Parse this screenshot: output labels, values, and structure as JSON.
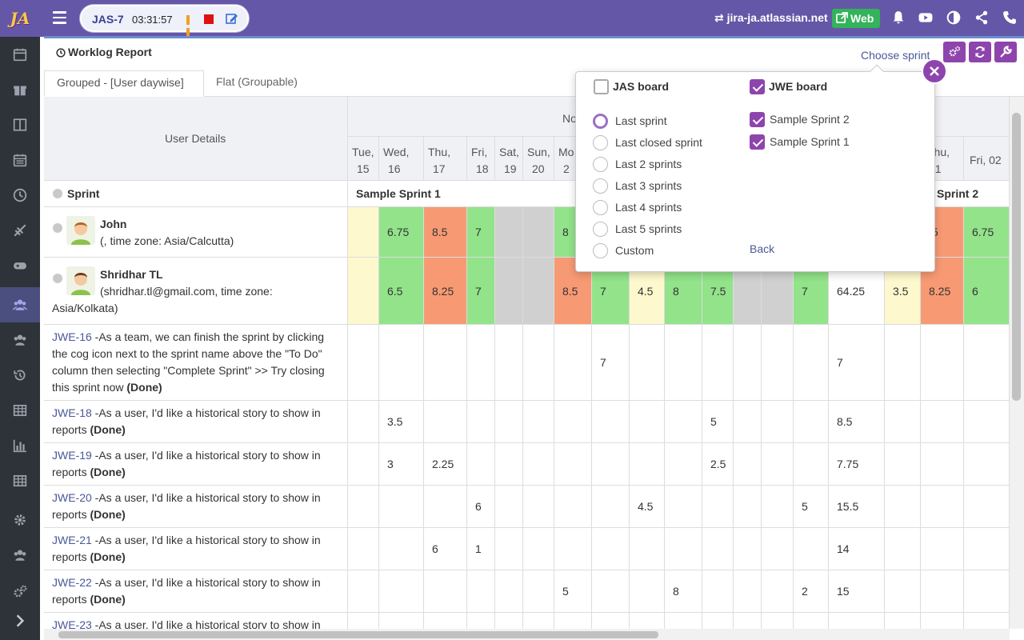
{
  "app": {
    "logo": "JA"
  },
  "timer": {
    "issue_key": "JAS-7",
    "time": "03:31:57"
  },
  "topbar": {
    "instance": "jira-ja.atlassian.net",
    "web_label": "Web"
  },
  "sidebar": {
    "items": [
      "calendar-icon",
      "gift-icon",
      "columns-icon",
      "calendar-icon",
      "clock-icon",
      "plane-icon",
      "gamepad-icon",
      "users-icon",
      "users-icon",
      "history-icon",
      "table-icon",
      "bar-chart-icon",
      "table-icon",
      "gear-icon",
      "users-icon",
      "gears-icon",
      "chevron-right-icon"
    ],
    "active_index": 7
  },
  "report": {
    "title": "Worklog Report",
    "choose_sprint": "Choose sprint"
  },
  "tabs": [
    {
      "label": "Grouped - [User daywise]"
    },
    {
      "label": "Flat (Groupable)"
    }
  ],
  "grid": {
    "user_details_header": "User Details",
    "month_header": "No",
    "days": [
      {
        "day": "Tue,",
        "date": "15"
      },
      {
        "day": "Wed,",
        "date": "16"
      },
      {
        "day": "Thu,",
        "date": "17"
      },
      {
        "day": "Fri,",
        "date": "18"
      },
      {
        "day": "Sat,",
        "date": "19"
      },
      {
        "day": "Sun,",
        "date": "20"
      },
      {
        "day": "Mo",
        "date": "2"
      }
    ],
    "days_right": [
      {
        "day": "Thu,",
        "date": "01"
      },
      {
        "label": "Fri, 02"
      }
    ],
    "sprint_label": "Sprint",
    "sprint_1": "Sample Sprint 1",
    "sprint_2": "Sprint 2",
    "users": [
      {
        "name": "John",
        "detail": "(, time zone: Asia/Calcutta)"
      },
      {
        "name": "Shridhar TL",
        "detail_line1": "(shridhar.tl@gmail.com, time zone:",
        "detail_line2": "Asia/Kolkata)"
      }
    ],
    "john_values": [
      "",
      "6.75",
      "8.5",
      "7",
      "",
      "",
      "8"
    ],
    "john_right": [
      ".5",
      "6.75"
    ],
    "shridhar_values": [
      "",
      "6.5",
      "8.25",
      "7",
      "",
      "",
      "8.5",
      "7",
      "4.5",
      "8",
      "7.5",
      "",
      "",
      "7",
      "64.25",
      "3.5",
      "8.25",
      "6"
    ],
    "issues": [
      {
        "key": "JWE-16",
        "lines": [
          " -As a team, we can finish the sprint by clicking",
          "the cog icon next to the sprint name above the \"To Do\"",
          "column then selecting \"Complete Sprint\" >> Try closing",
          "this sprint now "
        ],
        "status": "(Done)",
        "vals": {
          "7": "7",
          "14": "7"
        }
      },
      {
        "key": "JWE-18",
        "lines": [
          " -As a user, I'd like a historical story to show in",
          "reports "
        ],
        "status": "(Done)",
        "vals": {
          "1": "3.5",
          "10": "5",
          "14": "8.5"
        }
      },
      {
        "key": "JWE-19",
        "lines": [
          " -As a user, I'd like a historical story to show in",
          "reports "
        ],
        "status": "(Done)",
        "vals": {
          "1": "3",
          "2": "2.25",
          "10": "2.5",
          "14": "7.75"
        }
      },
      {
        "key": "JWE-20",
        "lines": [
          " -As a user, I'd like a historical story to show in",
          "reports "
        ],
        "status": "(Done)",
        "vals": {
          "3": "6",
          "8": "4.5",
          "13": "5",
          "14": "15.5"
        }
      },
      {
        "key": "JWE-21",
        "lines": [
          " -As a user, I'd like a historical story to show in",
          "reports "
        ],
        "status": "(Done)",
        "vals": {
          "2": "6",
          "3": "1",
          "14": "14"
        }
      },
      {
        "key": "JWE-22",
        "lines": [
          " -As a user, I'd like a historical story to show in",
          "reports "
        ],
        "status": "(Done)",
        "vals": {
          "6": "5",
          "9": "8",
          "13": "2",
          "14": "15"
        }
      },
      {
        "key": "JWE-23",
        "lines": [
          " -As a user, I'd like a historical story to show in"
        ],
        "status": "",
        "vals": {}
      }
    ]
  },
  "popover": {
    "board_a": "JAS board",
    "board_a_checked": false,
    "board_b": "JWE board",
    "board_b_checked": true,
    "options": [
      "Last sprint",
      "Last closed sprint",
      "Last 2 sprints",
      "Last 3 sprints",
      "Last 4 sprints",
      "Last 5 sprints",
      "Custom"
    ],
    "selected_option": 0,
    "sprints": [
      "Sample Sprint 2",
      "Sample Sprint 1"
    ],
    "back_label": "Back"
  },
  "colors": {
    "accent": "#8e44ad",
    "topbar": "#6557a7",
    "link": "#4a5898",
    "green": "#92e38a",
    "red": "#f79a74",
    "gray": "#d0d0d0",
    "yellow": "#fdf8cd"
  }
}
